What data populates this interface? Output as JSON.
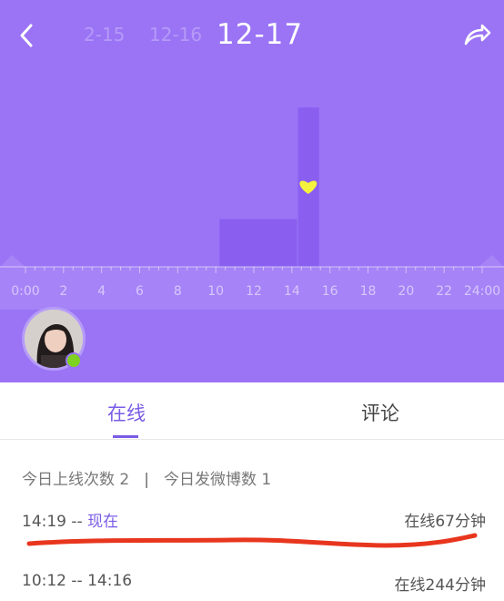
{
  "header": {
    "dates": [
      "2-15",
      "12-16",
      "12-17"
    ],
    "selected_date": "12-17"
  },
  "chart_data": {
    "type": "bar",
    "x_ticks": [
      "0:00",
      "2",
      "4",
      "6",
      "8",
      "10",
      "12",
      "14",
      "16",
      "18",
      "20",
      "22",
      "24:00"
    ],
    "xlim": [
      0,
      24
    ],
    "bars": [
      {
        "start": 10.2,
        "end": 14.27,
        "level": 0.3
      },
      {
        "start": 14.32,
        "end": 15.43,
        "level": 1.0
      }
    ],
    "marker": {
      "icon": "heart-icon",
      "x": 14.86,
      "color": "#f4f23d"
    },
    "colors": {
      "background": "#9a74f5",
      "bars": "#8a5ff0"
    }
  },
  "avatar": {
    "online": true
  },
  "tabs": {
    "online": "在线",
    "comments": "评论",
    "active": "online"
  },
  "stats": {
    "logins": "今日上线次数 2",
    "separator": "|",
    "posts": "今日发微博数 1"
  },
  "sessions": [
    {
      "start": "14:19",
      "dash": "--",
      "end": "现在",
      "duration": "在线67分钟"
    },
    {
      "start": "10:12",
      "dash": "--",
      "end": "14:16",
      "duration": "在线244分钟"
    }
  ]
}
